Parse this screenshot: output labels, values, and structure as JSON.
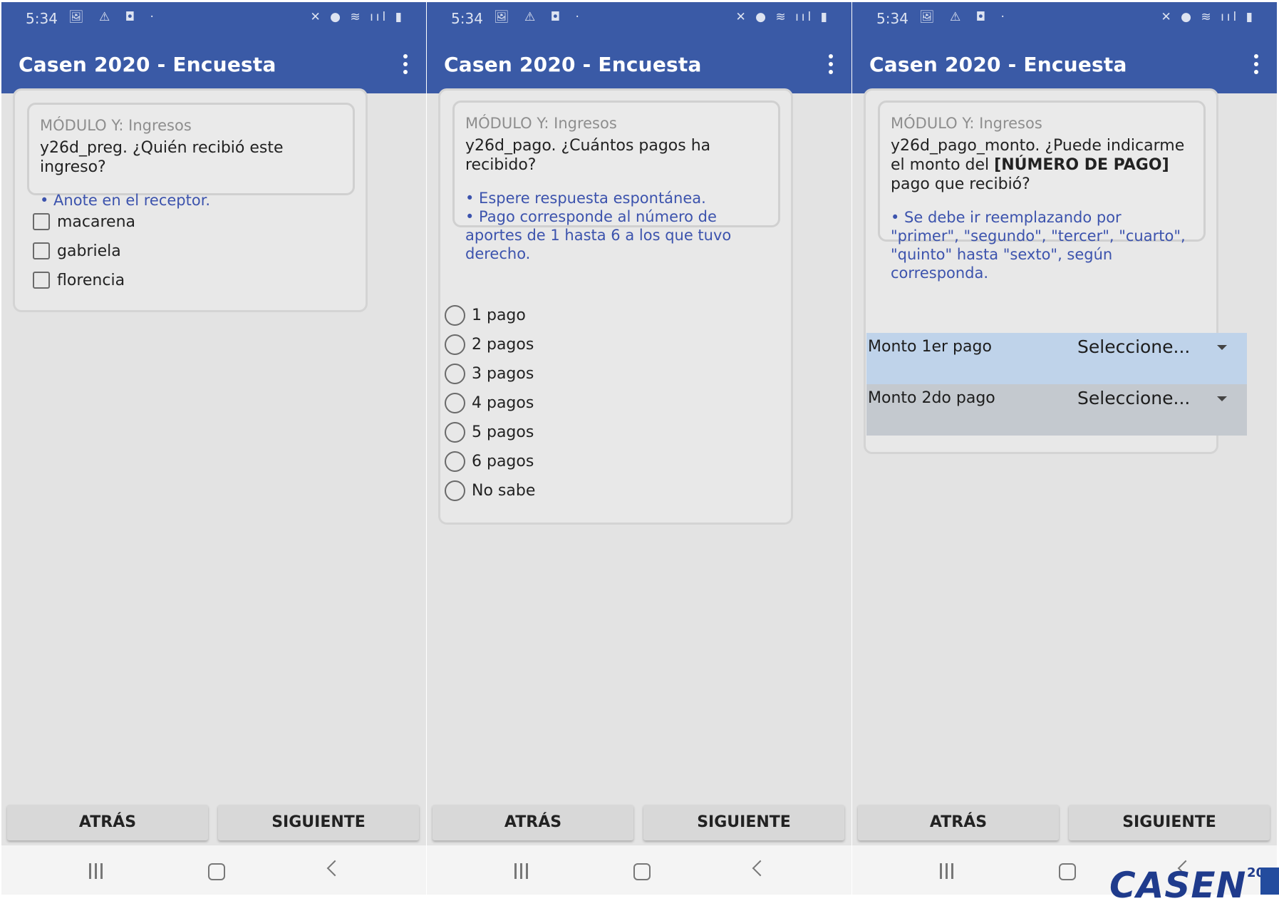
{
  "common": {
    "status_time": "5:34",
    "status_left_icons": "🖼 ⚠ ◘ ·",
    "status_right_icons": "✕ ● ≋ ııl ▮",
    "app_title": "Casen 2020 - Encuesta",
    "back_label": "ATRÁS",
    "next_label": "SIGUIENTE"
  },
  "screens": [
    {
      "module": "MÓDULO Y: Ingresos",
      "question_html": "y26d_preg. ¿Quién recibió este ingreso?",
      "hint_html": "• Anote en el receptor.",
      "checkbox_options": [
        "macarena",
        "gabriela",
        "florencia"
      ]
    },
    {
      "module": "MÓDULO Y: Ingresos",
      "question_html": "y26d_pago. ¿Cuántos pagos ha recibido?",
      "hint_html": "• Espere respuesta espontánea.<br>• Pago corresponde al número de aportes de 1 hasta 6 a los que tuvo derecho.",
      "radio_options": [
        "1 pago",
        "2 pagos",
        "3 pagos",
        "4 pagos",
        "5 pagos",
        "6 pagos",
        "No sabe"
      ]
    },
    {
      "module": "MÓDULO Y: Ingresos",
      "question_html": "y26d_pago_monto. ¿Puede indicarme el monto del <b>[NÚMERO DE PAGO]</b> pago que recibió?",
      "hint_html": "• Se debe ir reemplazando por \"primer\", \"segundo\", \"tercer\", \"cuarto\", \"quinto\" hasta \"sexto\", según corresponda.",
      "dropdowns": [
        {
          "label": "Monto 1er pago",
          "value": "Seleccione...",
          "bg": "#bfd3ea"
        },
        {
          "label": "Monto 2do pago",
          "value": "Seleccione...",
          "bg": "#c4c9cf"
        }
      ]
    }
  ],
  "logo": {
    "text": "CASEN",
    "sup": "20"
  }
}
